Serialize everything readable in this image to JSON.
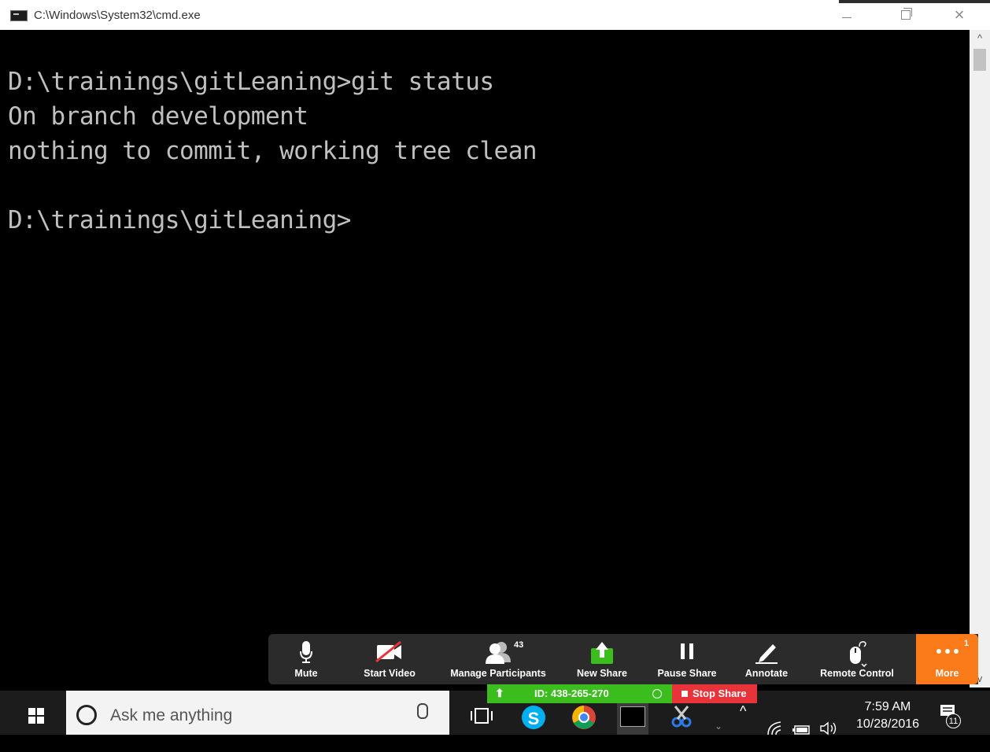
{
  "window": {
    "title": "C:\\Windows\\System32\\cmd.exe",
    "icon": "cmd-icon",
    "controls": {
      "minimize": "minimize-icon",
      "maximize": "restore-icon",
      "close": "×"
    }
  },
  "console": {
    "lines": [
      "D:\\trainings\\gitLeaning>git status",
      "On branch development",
      "nothing to commit, working tree clean",
      "",
      "D:\\trainings\\gitLeaning>"
    ],
    "scroll_up": "^",
    "scroll_down": "v"
  },
  "zoom_toolbar": {
    "buttons": [
      {
        "id": "mute",
        "label": "Mute",
        "icon": "microphone-icon"
      },
      {
        "id": "start_video",
        "label": "Start Video",
        "icon": "video-off-icon"
      },
      {
        "id": "participants",
        "label": "Manage Participants",
        "icon": "participants-icon",
        "badge": "43"
      },
      {
        "id": "new_share",
        "label": "New Share",
        "icon": "share-screen-icon"
      },
      {
        "id": "pause_share",
        "label": "Pause Share",
        "icon": "pause-icon"
      },
      {
        "id": "annotate",
        "label": "Annotate",
        "icon": "pencil-icon"
      },
      {
        "id": "remote_control",
        "label": "Remote Control",
        "icon": "mouse-icon"
      },
      {
        "id": "more",
        "label": "More",
        "icon": "more-dots-icon",
        "badge": "1"
      }
    ],
    "colors": {
      "bar": "#2b2b2b",
      "more": "#fb7a1a",
      "share_green": "#3bbd1e",
      "stop_red": "#e8333a"
    }
  },
  "share_status": {
    "meeting_id": "ID: 438-265-270",
    "stop_label": "Stop Share"
  },
  "taskbar": {
    "search_placeholder": "Ask me anything",
    "apps": [
      "task-view-icon",
      "skype-icon",
      "chrome-icon",
      "cmd-taskbar-icon",
      "snipping-tool-icon"
    ],
    "tray": {
      "chevron": "^",
      "time": "7:59 AM",
      "date": "10/28/2016",
      "notifications": "11"
    }
  }
}
